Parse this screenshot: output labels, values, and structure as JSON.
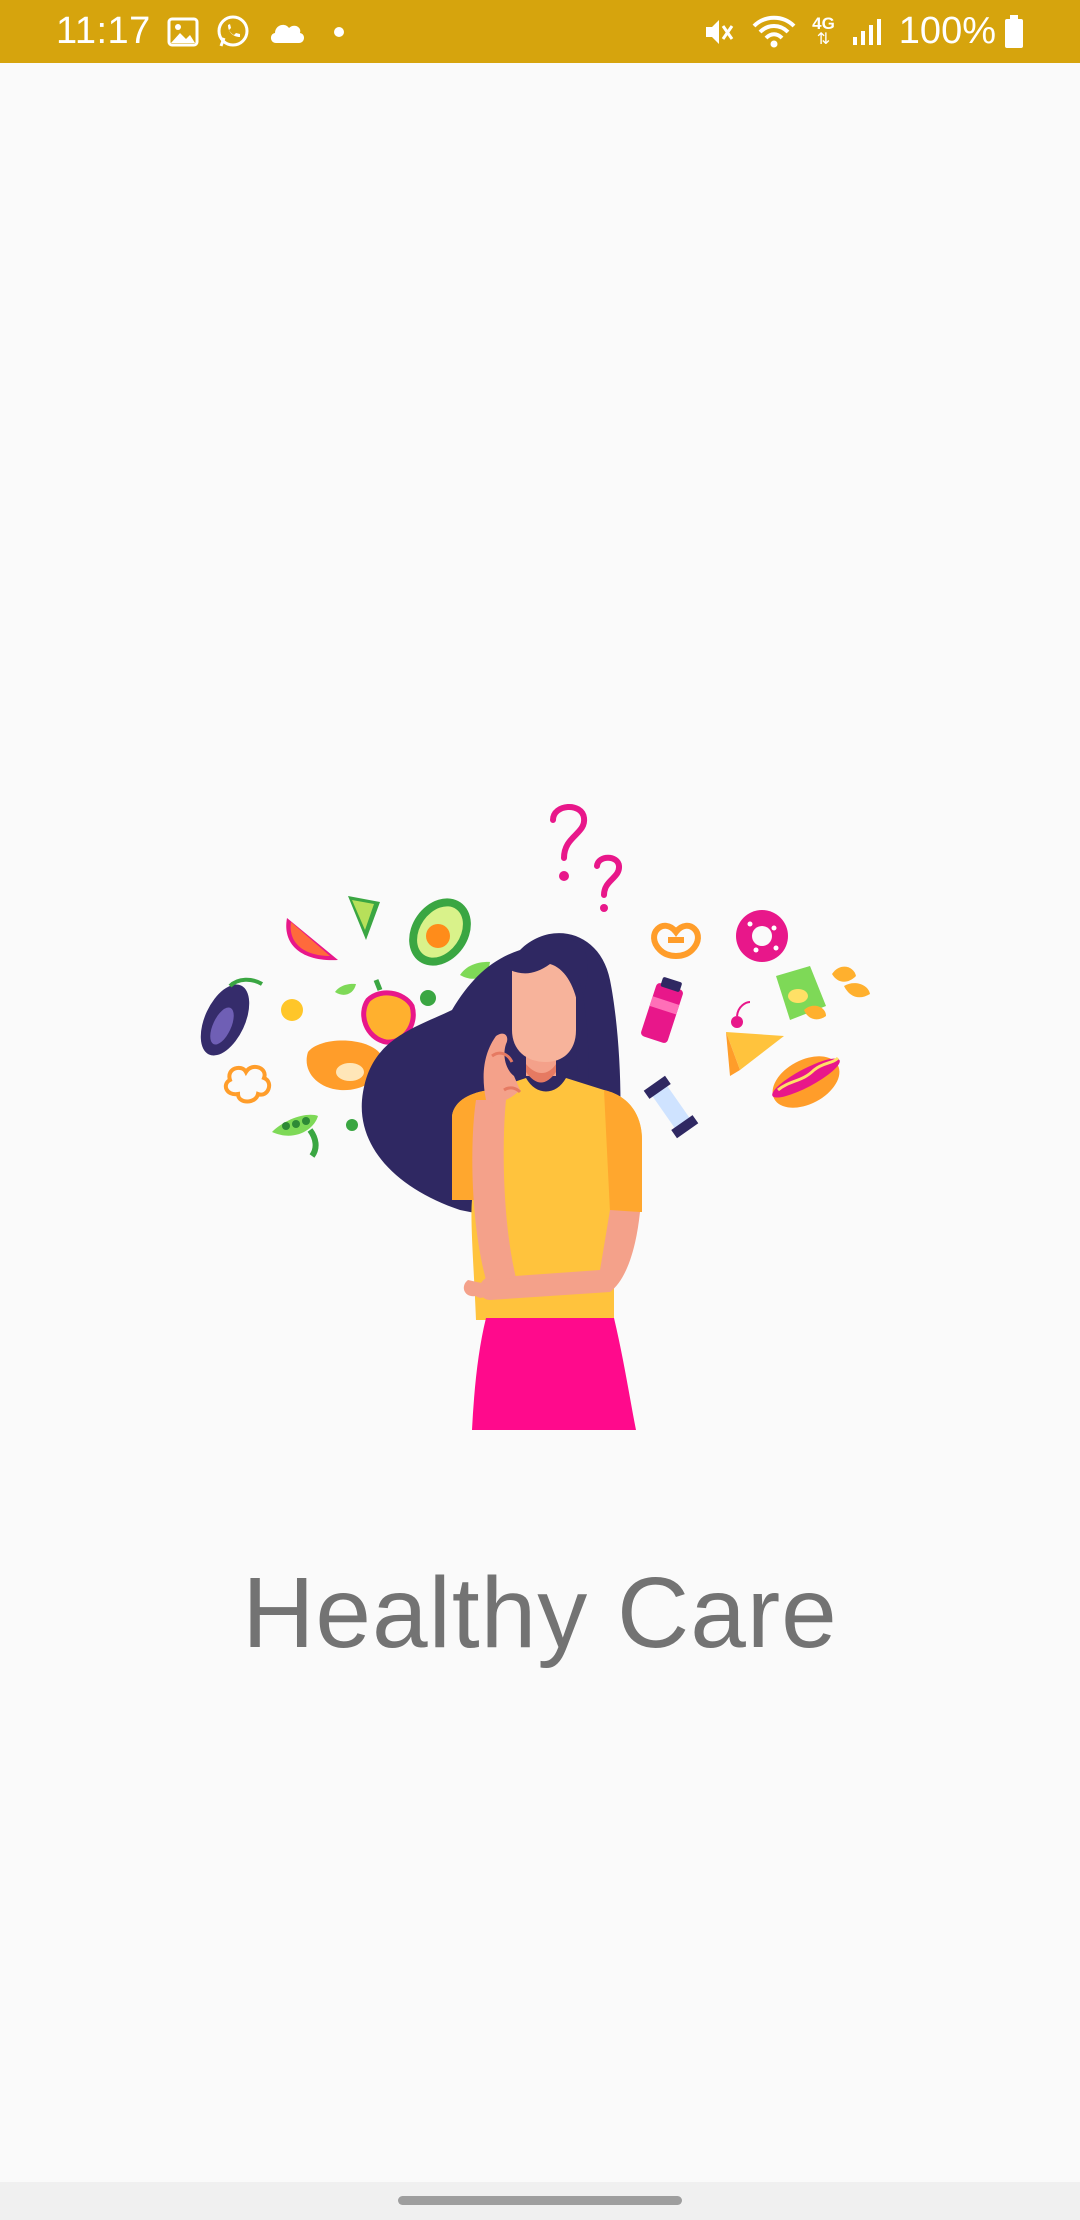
{
  "status_bar": {
    "time": "11:17",
    "battery": "100%",
    "icons_left": [
      "gallery-icon",
      "whatsapp-icon",
      "cloud-icon",
      "dot-icon"
    ],
    "icons_right": [
      "mute-icon",
      "wifi-icon",
      "network-4g-icon",
      "signal-icon",
      "battery-icon"
    ],
    "network_label": "4G",
    "background_color": "#d6a40d"
  },
  "splash": {
    "illustration": "thinking-woman-food-illustration",
    "title": "Healthy Care",
    "title_color": "#737373",
    "background_color": "#fafafa"
  },
  "navigation": {
    "home_indicator": "home-indicator"
  }
}
